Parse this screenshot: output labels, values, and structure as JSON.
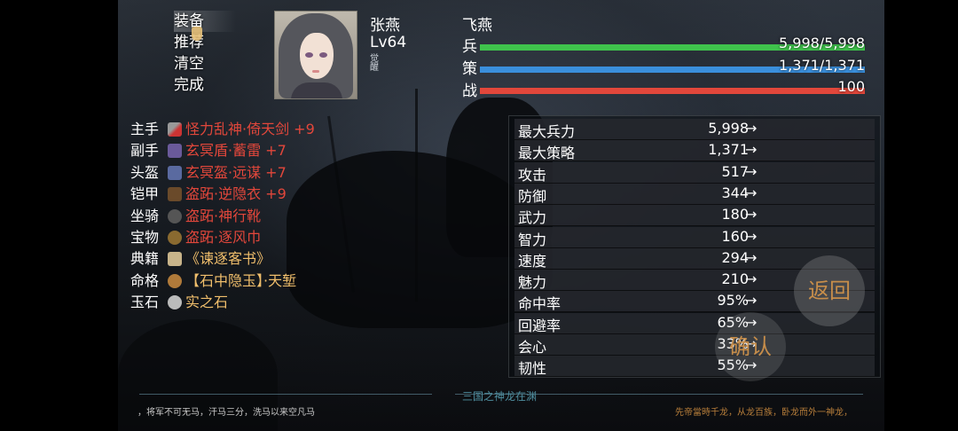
{
  "menu": {
    "items": [
      "装备",
      "推荐",
      "清空",
      "完成"
    ]
  },
  "hero": {
    "name": "张燕",
    "level": "Lv64",
    "awaken_mark": "觉醒"
  },
  "unit": {
    "name": "飞燕"
  },
  "bars": [
    {
      "label": "兵",
      "value_text": "5,998/5,998",
      "fraction": 1.0,
      "color": "#3fc34c"
    },
    {
      "label": "策",
      "value_text": "1,371/1,371",
      "fraction": 1.0,
      "color": "#3a8fdc"
    },
    {
      "label": "战",
      "value_text": "100",
      "fraction": 1.0,
      "color": "#e2473b"
    }
  ],
  "equipment": [
    {
      "slot": "主手",
      "name": "怪力乱神·倚天剑 +9",
      "icon": "sword-icon",
      "color": "#e2473b"
    },
    {
      "slot": "副手",
      "name": "玄冥盾·蓄雷 +7",
      "icon": "shield-icon",
      "color": "#e2473b"
    },
    {
      "slot": "头盔",
      "name": "玄冥盔·远谋 +7",
      "icon": "helmet-icon",
      "color": "#e2473b"
    },
    {
      "slot": "铠甲",
      "name": "盗跖·逆隐衣 +9",
      "icon": "armor-icon",
      "color": "#e2473b"
    },
    {
      "slot": "坐骑",
      "name": "盗跖·神行靴",
      "icon": "boots-icon",
      "color": "#e2473b"
    },
    {
      "slot": "宝物",
      "name": "盗跖·逐风巾",
      "icon": "treasure-icon",
      "color": "#e2473b"
    },
    {
      "slot": "典籍",
      "name": "《谏逐客书》",
      "icon": "book-icon",
      "color": "#f1bf6c"
    },
    {
      "slot": "命格",
      "name": "【石中隐玉】·天堑",
      "icon": "fate-icon",
      "color": "#f1bf6c"
    },
    {
      "slot": "玉石",
      "name": "实之石",
      "icon": "gem-icon",
      "color": "#f1bf6c"
    }
  ],
  "stats": [
    {
      "label": "最大兵力",
      "value": "5,998"
    },
    {
      "label": "最大策略",
      "value": "1,371"
    },
    {
      "label": "攻击",
      "value": "517"
    },
    {
      "label": "防御",
      "value": "344"
    },
    {
      "label": "武力",
      "value": "180"
    },
    {
      "label": "智力",
      "value": "160"
    },
    {
      "label": "速度",
      "value": "294"
    },
    {
      "label": "魅力",
      "value": "210"
    },
    {
      "label": "命中率",
      "value": "95%"
    },
    {
      "label": "回避率",
      "value": "65%"
    },
    {
      "label": "会心",
      "value": "33%"
    },
    {
      "label": "韧性",
      "value": "55%"
    }
  ],
  "stat_arrow": "→",
  "buttons": {
    "back": "返回",
    "confirm": "确认"
  },
  "footer": {
    "left": "，将军不可无马，汗马三分，洗马以来空凡马",
    "center": "三国之神龙在渊",
    "right": "先帝當時千龙，从龙百族，卧龙而外一神龙，"
  }
}
